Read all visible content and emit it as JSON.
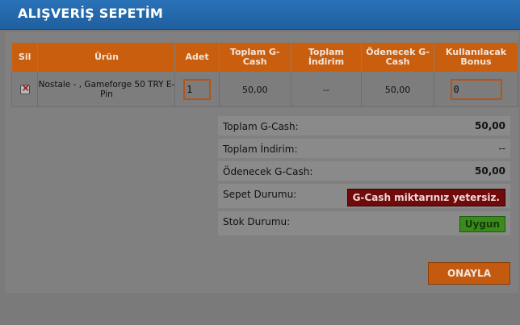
{
  "header": {
    "title": "ALIŞVERİŞ SEPETİM"
  },
  "table": {
    "columns": [
      "Sil",
      "Ürün",
      "Adet",
      "Toplam G-Cash",
      "Toplam İndirim",
      "Ödenecek G-Cash",
      "Kullanılacak Bonus"
    ],
    "row": {
      "product": "Nostale - , Gameforge 50 TRY E-Pin",
      "quantity": "1",
      "total_gcash": "50,00",
      "total_discount": "--",
      "payable_gcash": "50,00",
      "bonus": "0"
    }
  },
  "summary": {
    "total_gcash_label": "Toplam G-Cash:",
    "total_gcash_value": "50,00",
    "total_discount_label": "Toplam İndirim:",
    "total_discount_value": "--",
    "payable_gcash_label": "Ödenecek G-Cash:",
    "payable_gcash_value": "50,00",
    "cart_status_label": "Sepet Durumu:",
    "cart_status_value": "G-Cash miktarınız yetersiz.",
    "stock_status_label": "Stok Durumu:",
    "stock_status_value": "Uygun"
  },
  "actions": {
    "confirm_label": "ONAYLA"
  },
  "colors": {
    "header_blue": "#2a72b8",
    "table_header_orange": "#c95f0e",
    "warning_red": "#6f0b0b",
    "ok_green": "#3a8b1b"
  }
}
